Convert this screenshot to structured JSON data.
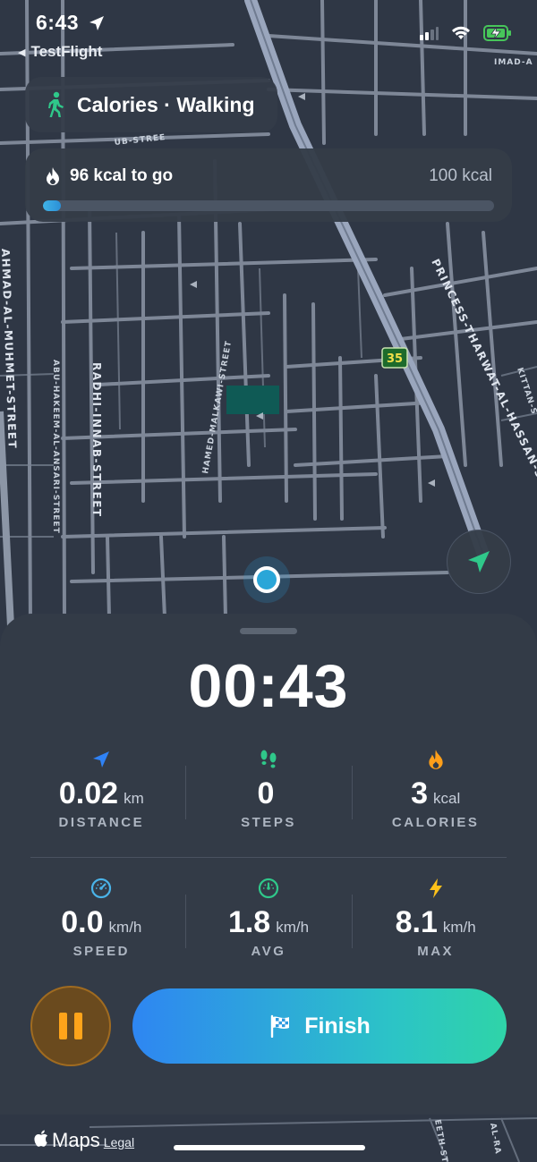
{
  "status_bar": {
    "time": "6:43",
    "back_app": "TestFlight",
    "icons": [
      "location-arrow-icon",
      "signal-icon",
      "wifi-icon",
      "battery-charging-icon"
    ]
  },
  "goal": {
    "title": "Calories · Walking",
    "icon": "walking-person-icon"
  },
  "progress": {
    "remaining_label": "96 kcal to go",
    "target_label": "100 kcal",
    "fraction": 0.04,
    "icon": "flame-icon"
  },
  "map": {
    "street_labels": [
      "RADHI-INNAB-STREET",
      "HAMED-MALKAWI-STREET",
      "PRINCESS-THARWAT-AL-HASSAN-STREET",
      "AHMAD-AL-MUHMET-STREET",
      "ABU-HAKEEM-AL-ANSARI-STREET",
      "IMAD-A",
      "UB-STREE",
      "KITTAN-S",
      "EETH-STRE",
      "AL-RA"
    ],
    "route_badge": "35",
    "highlight_color": "#0f5a55"
  },
  "workout": {
    "timer": "00:43",
    "stats": [
      {
        "id": "distance",
        "value": "0.02",
        "unit": "km",
        "label": "DISTANCE",
        "icon": "navigation-arrow-icon",
        "color": "#2f82f6"
      },
      {
        "id": "steps",
        "value": "0",
        "unit": "",
        "label": "STEPS",
        "icon": "footprints-icon",
        "color": "#2fc88a"
      },
      {
        "id": "calories",
        "value": "3",
        "unit": "kcal",
        "label": "CALORIES",
        "icon": "flame-icon",
        "color": "#ff9f1a"
      },
      {
        "id": "speed",
        "value": "0.0",
        "unit": "km/h",
        "label": "SPEED",
        "icon": "speedometer-icon",
        "color": "#4ab3e8"
      },
      {
        "id": "avg",
        "value": "1.8",
        "unit": "km/h",
        "label": "AVG",
        "icon": "gauge-icon",
        "color": "#2fc88a"
      },
      {
        "id": "max",
        "value": "8.1",
        "unit": "km/h",
        "label": "MAX",
        "icon": "bolt-icon",
        "color": "#ffc21a"
      }
    ]
  },
  "controls": {
    "finish_label": "Finish",
    "pause_icon": "pause-icon",
    "finish_icon": "checkered-flag-icon",
    "recenter_icon": "location-arrow-icon"
  },
  "footer": {
    "maps_label": "Maps",
    "legal_label": "Legal"
  }
}
